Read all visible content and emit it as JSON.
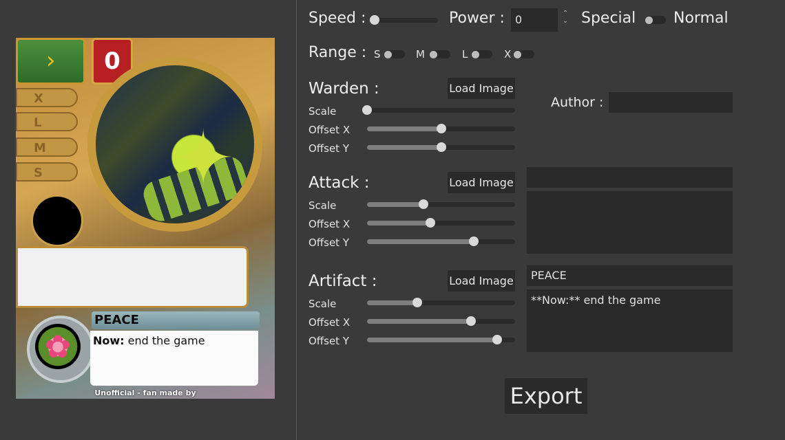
{
  "card": {
    "power_value": "0",
    "range_tabs": [
      "X",
      "L",
      "M",
      "S"
    ],
    "name": "PEACE",
    "desc_bold": "Now:",
    "desc_rest": " end the game",
    "footer": "Unofficial - fan made by"
  },
  "top_controls": {
    "speed_label": "Speed :",
    "speed_slider_fraction": 0.0,
    "power_label": "Power :",
    "power_value": "0",
    "special_label": "Special",
    "normal_label": "Normal",
    "range_label": "Range :",
    "range_options": [
      "S",
      "M",
      "L",
      "X"
    ]
  },
  "sections": [
    {
      "title": "Warden :",
      "load_button": "Load Image",
      "sliders": [
        {
          "label": "Scale",
          "value": 0.0
        },
        {
          "label": "Offset X",
          "value": 0.5
        },
        {
          "label": "Offset Y",
          "value": 0.5
        }
      ]
    },
    {
      "title": "Attack :",
      "load_button": "Load Image",
      "sliders": [
        {
          "label": "Scale",
          "value": 0.38
        },
        {
          "label": "Offset X",
          "value": 0.43
        },
        {
          "label": "Offset Y",
          "value": 0.72
        }
      ]
    },
    {
      "title": "Artifact :",
      "load_button": "Load Image",
      "sliders": [
        {
          "label": "Scale",
          "value": 0.34
        },
        {
          "label": "Offset X",
          "value": 0.7
        },
        {
          "label": "Offset Y",
          "value": 0.88
        }
      ]
    }
  ],
  "author": {
    "label": "Author :",
    "value": ""
  },
  "attack_fields": {
    "name_value": "",
    "text_value": ""
  },
  "artifact_fields": {
    "name_value": "PEACE",
    "text_value": "**Now:** end the game"
  },
  "export_label": "Export"
}
